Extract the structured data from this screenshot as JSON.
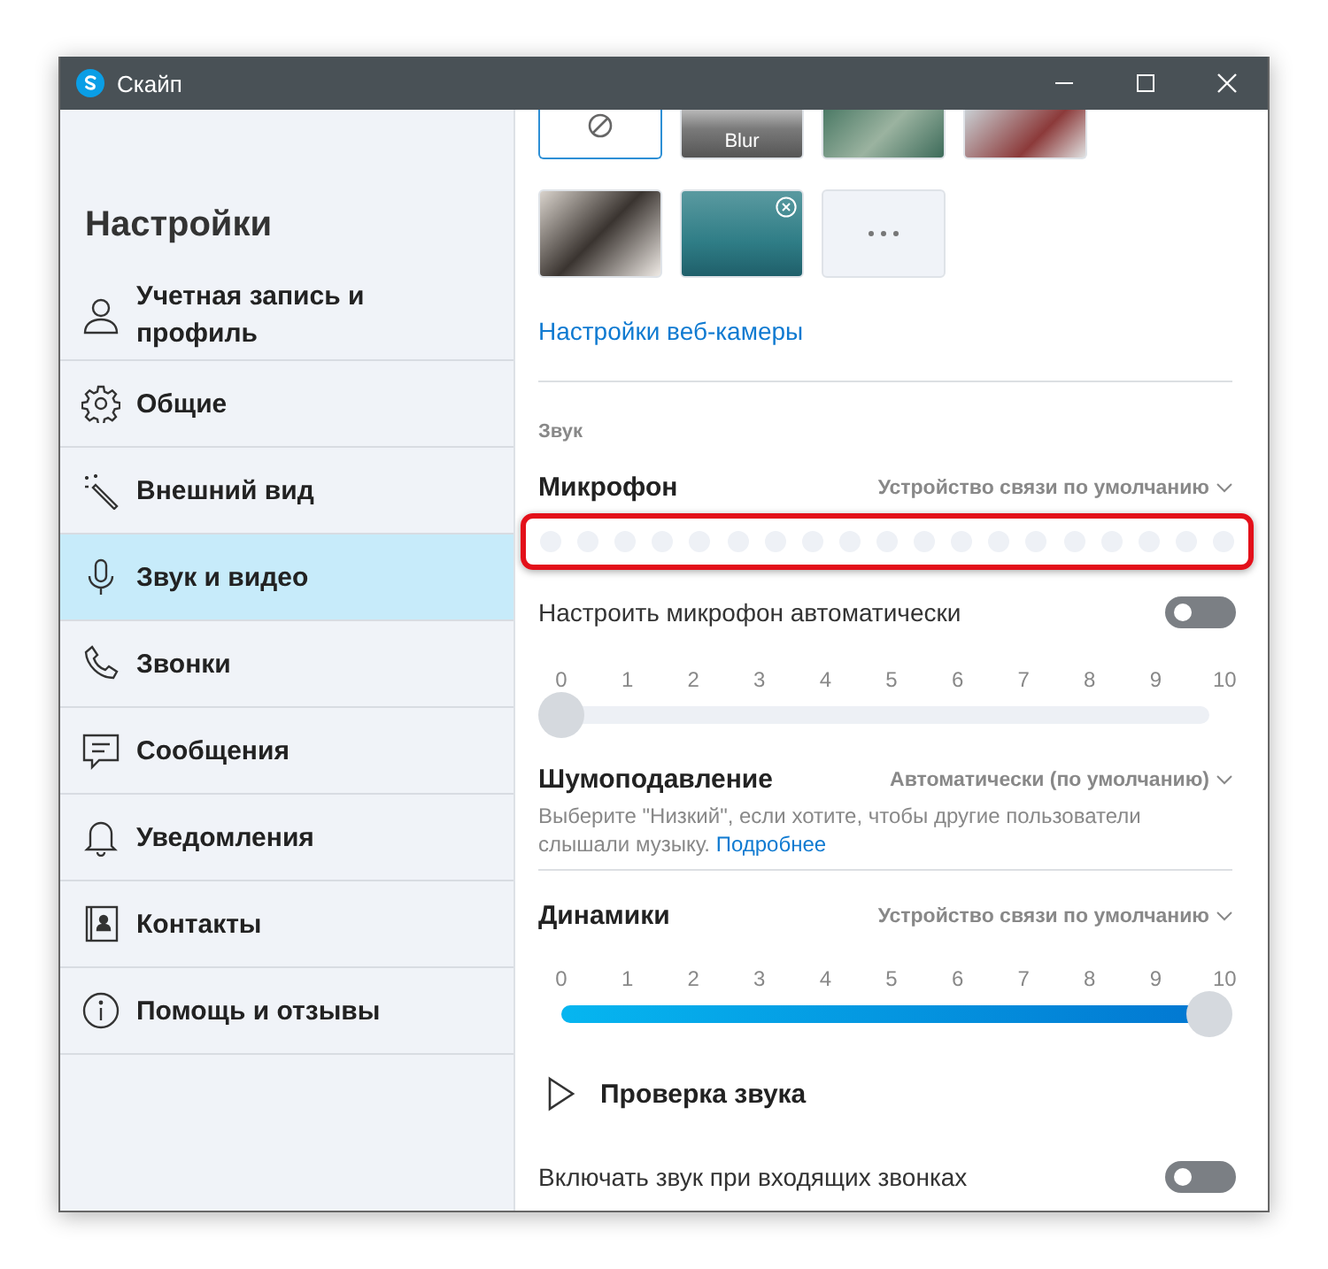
{
  "window": {
    "title": "Скайп"
  },
  "sidebar": {
    "heading": "Настройки",
    "items": [
      {
        "label": "Учетная запись и профиль",
        "selected": false
      },
      {
        "label": "Общие",
        "selected": false
      },
      {
        "label": "Внешний вид",
        "selected": false
      },
      {
        "label": "Звук и видео",
        "selected": true
      },
      {
        "label": "Звонки",
        "selected": false
      },
      {
        "label": "Сообщения",
        "selected": false
      },
      {
        "label": "Уведомления",
        "selected": false
      },
      {
        "label": "Контакты",
        "selected": false
      },
      {
        "label": "Помощь и отзывы",
        "selected": false
      }
    ]
  },
  "backgrounds": [
    {
      "kind": "none",
      "selected": true,
      "removable": false
    },
    {
      "kind": "blur",
      "label": "Blur",
      "selected": false,
      "removable": false
    },
    {
      "kind": "photo",
      "selected": false,
      "removable": false
    },
    {
      "kind": "photo",
      "selected": false,
      "removable": false
    },
    {
      "kind": "photo",
      "selected": false,
      "removable": false
    },
    {
      "kind": "photo",
      "selected": false,
      "removable": true
    },
    {
      "kind": "more",
      "selected": false,
      "removable": false
    }
  ],
  "webcam_link": "Настройки веб-камеры",
  "section_label": "Звук",
  "microphone": {
    "label": "Микрофон",
    "device": "Устройство связи по умолчанию",
    "level": 0,
    "highlighted": true
  },
  "auto_adjust": {
    "label": "Настроить микрофон автоматически",
    "on": false
  },
  "mic_slider": {
    "ticks": [
      "0",
      "1",
      "2",
      "3",
      "4",
      "5",
      "6",
      "7",
      "8",
      "9",
      "10"
    ],
    "level": 0
  },
  "noise": {
    "label": "Шумоподавление",
    "value": "Автоматически (по умолчанию)",
    "hint": "Выберите \"Низкий\", если хотите, чтобы другие пользователи слышали музыку.",
    "link": "Подробнее"
  },
  "speakers": {
    "label": "Динамики",
    "device": "Устройство связи по умолчанию",
    "ticks": [
      "0",
      "1",
      "2",
      "3",
      "4",
      "5",
      "6",
      "7",
      "8",
      "9",
      "10"
    ],
    "level": 1
  },
  "test_sound": "Проверка звука",
  "incoming": {
    "label": "Включать звук при входящих звонках",
    "on": false
  }
}
